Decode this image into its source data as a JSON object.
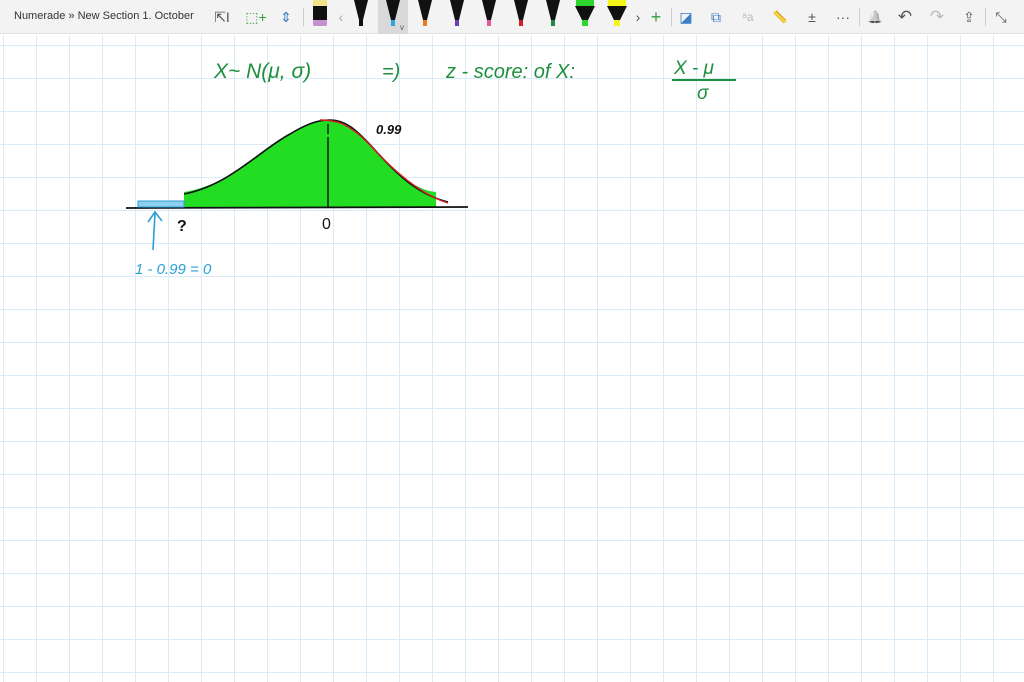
{
  "breadcrumb": "Numerade » New Section 1. October",
  "toolbar": {
    "tools": [
      {
        "name": "type-select-icon",
        "glyph": "⇱I"
      },
      {
        "name": "lasso-select-icon",
        "glyph": "⬚+"
      },
      {
        "name": "add-space-icon",
        "glyph": "⇕"
      }
    ],
    "scroll_left": "‹",
    "scroll_right": "›",
    "add_pen": "+",
    "pens": [
      {
        "name": "eraser-pen",
        "color": "#111111",
        "tip": "#c58fd0",
        "cap": "#f2e38a"
      },
      {
        "name": "black-pen",
        "color": "#111111",
        "tip": "#111111"
      },
      {
        "name": "blue-pen",
        "color": "#111111",
        "tip": "#2aa7df",
        "selected": true
      },
      {
        "name": "orange-pen",
        "color": "#111111",
        "tip": "#f07a1a"
      },
      {
        "name": "purple-pen",
        "color": "#111111",
        "tip": "#6a3fb5"
      },
      {
        "name": "pink-pen",
        "color": "#111111",
        "tip": "#e8559a"
      },
      {
        "name": "red-pen",
        "color": "#111111",
        "tip": "#d21f2a"
      },
      {
        "name": "green-pen",
        "color": "#111111",
        "tip": "#1d8a48"
      },
      {
        "name": "green-highlighter",
        "color": "#111111",
        "tip": "#2fd52f",
        "cap": "#2fd52f"
      },
      {
        "name": "yellow-highlighter",
        "color": "#111111",
        "tip": "#f4f41a",
        "cap": "#f4f41a"
      }
    ],
    "actions": [
      {
        "name": "ink-to-shape-icon",
        "glyph": "◪"
      },
      {
        "name": "ink-to-text-icon",
        "glyph": "⧉"
      },
      {
        "name": "ink-to-math-icon",
        "glyph": "ᵃa"
      },
      {
        "name": "ruler-icon",
        "glyph": "📏"
      },
      {
        "name": "math-icon",
        "glyph": "±"
      },
      {
        "name": "more-icon",
        "glyph": "···"
      }
    ],
    "right": [
      {
        "name": "notifications-icon",
        "glyph": "🔔"
      },
      {
        "name": "undo-icon",
        "glyph": "↶"
      },
      {
        "name": "redo-icon",
        "glyph": "↷"
      },
      {
        "name": "share-icon",
        "glyph": "⇪"
      },
      {
        "name": "collapse-icon",
        "glyph": "⤡"
      }
    ]
  },
  "ink": {
    "line1_left": "X~ N(μ, σ)",
    "arrow": "=)",
    "line1_mid": "z - score: of X:",
    "numerator": "X - μ",
    "denominator": "σ",
    "area_label": "0.99",
    "zero_label": "0",
    "question": "?",
    "tail_calc": "1 - 0.99 = 0",
    "colors": {
      "green_ink": "#1e8f3e",
      "blue_ink": "#2a9fd6",
      "fill": "#22dd22",
      "curve": "#111111",
      "red": "#d02020"
    }
  }
}
